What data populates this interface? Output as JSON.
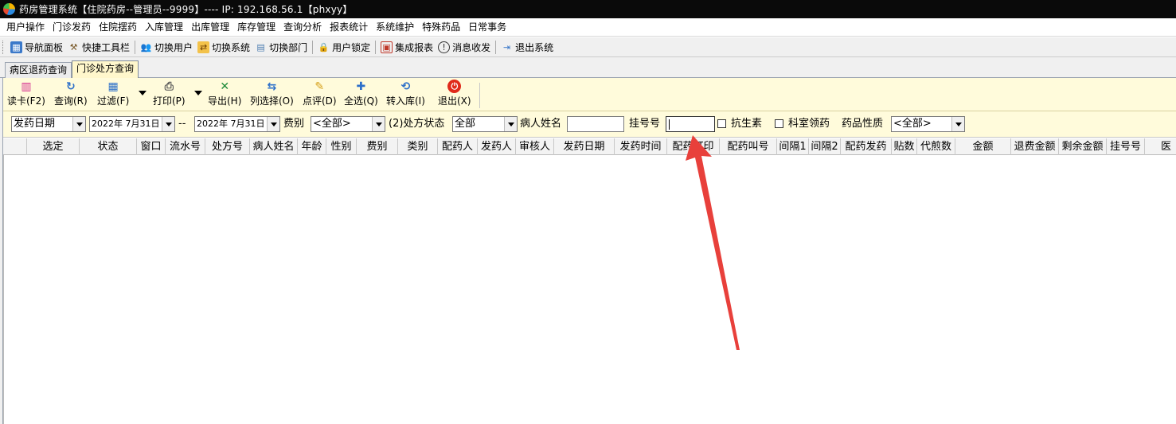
{
  "window": {
    "title": "药房管理系统【住院药房--管理员--9999】---- IP: 192.168.56.1【phxyy】"
  },
  "menu": [
    "用户操作",
    "门诊发药",
    "住院摆药",
    "入库管理",
    "出库管理",
    "库存管理",
    "查询分析",
    "报表统计",
    "系统维护",
    "特殊药品",
    "日常事务"
  ],
  "toolbar": {
    "items": [
      {
        "label": "导航面板",
        "icon": "navigation-panel-icon",
        "color": "#3a78c9"
      },
      {
        "label": "快捷工具栏",
        "icon": "shortcut-toolbar-icon",
        "color": "#7a5a2a"
      },
      {
        "label": "切换用户",
        "icon": "switch-user-icon",
        "color": "#c98a2a"
      },
      {
        "label": "切换系统",
        "icon": "switch-system-icon",
        "color": "#d68a1a"
      },
      {
        "label": "切换部门",
        "icon": "switch-department-icon",
        "color": "#4a7bb0"
      },
      {
        "label": "用户锁定",
        "icon": "user-lock-icon",
        "color": "#c9a02a"
      },
      {
        "label": "集成报表",
        "icon": "integrated-report-icon",
        "color": "#c0392b"
      },
      {
        "label": "消息收发",
        "icon": "message-icon",
        "color": "#333333"
      },
      {
        "label": "退出系统",
        "icon": "exit-system-icon",
        "color": "#3a78c9"
      }
    ]
  },
  "tabs": [
    "病区退药查询",
    "门诊处方查询"
  ],
  "actions": [
    {
      "label": "读卡(F2)",
      "icon": "card-reader-icon",
      "color": "#d62f8f"
    },
    {
      "label": "查询(R)",
      "icon": "refresh-query-icon",
      "color": "#2c6fc9"
    },
    {
      "label": "过滤(F)",
      "icon": "filter-icon",
      "color": "#2c6fc9"
    },
    {
      "label": "打印(P)",
      "icon": "printer-icon",
      "color": "#555555"
    },
    {
      "label": "导出(H)",
      "icon": "excel-export-icon",
      "color": "#1e8a3a"
    },
    {
      "label": "列选择(O)",
      "icon": "column-select-icon",
      "color": "#2c6fc9"
    },
    {
      "label": "点评(D)",
      "icon": "review-icon",
      "color": "#d6a01a"
    },
    {
      "label": "全选(Q)",
      "icon": "select-all-icon",
      "color": "#2c6fc9"
    },
    {
      "label": "转入库(I)",
      "icon": "transfer-in-icon",
      "color": "#2c6fc9"
    },
    {
      "label": "退出(X)",
      "icon": "power-exit-icon",
      "color": "#e02a1a"
    }
  ],
  "filters": {
    "date_type": "发药日期",
    "date_from": "2022年  7月31日",
    "separator": "--",
    "date_to": "2022年  7月31日",
    "fee_label": "费别",
    "fee_value": "<全部>",
    "status_label": "(2)处方状态",
    "status_value": "全部",
    "patient_name_label": "病人姓名",
    "patient_name_value": "",
    "reg_no_label": "挂号号",
    "reg_no_value": "",
    "antibiotic_label": "抗生素",
    "dept_label": "科室领药",
    "drug_nature_label": "药品性质",
    "drug_nature_value": "<全部>"
  },
  "columns": [
    "选定",
    "状态",
    "窗口",
    "流水号",
    "处方号",
    "病人姓名",
    "年龄",
    "性别",
    "费别",
    "类别",
    "配药人",
    "发药人",
    "审核人",
    "发药日期",
    "发药时间",
    "配药打印",
    "配药叫号",
    "间隔1",
    "间隔2",
    "配药发药",
    "贴数",
    "代煎数",
    "金额",
    "退费金额",
    "剩余金额",
    "挂号号",
    "医"
  ],
  "accent_color": "#e8403b"
}
